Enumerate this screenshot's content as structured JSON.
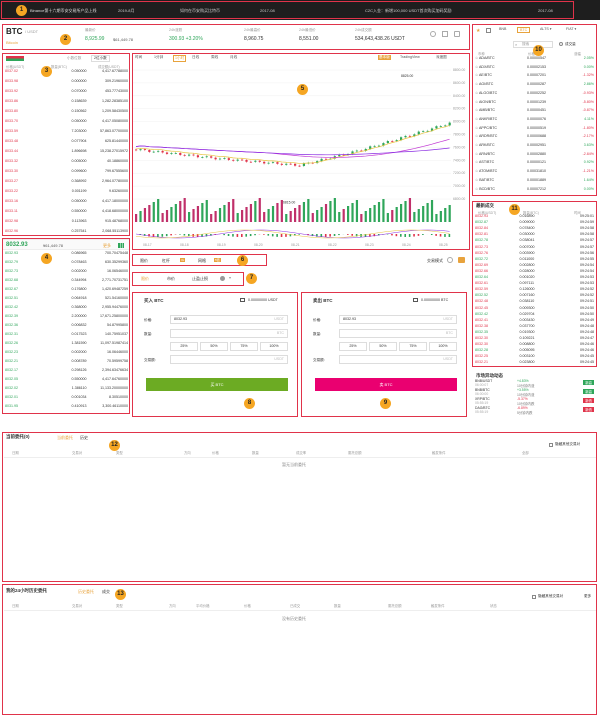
{
  "announce": {
    "text": "Binance第十六期币安交易所产品上线",
    "date1": "2019-8月",
    "text2": "如何在币安购买比特币",
    "date2": "2017-08",
    "text3": "C2C入金：新增100,000 USDT首次购买加码奖励",
    "date3": "2017-08"
  },
  "ticker": {
    "pair": "BTC",
    "quote": "/ USDT",
    "sub": "Bitcoin",
    "last_label": "最新价",
    "last_price": "8,925.99",
    "last_usd": "$61,449.78",
    "change_label": "24h涨跌",
    "change": "300.93 +3.20%",
    "high_label": "24h最高价",
    "high": "8,960.75",
    "low_label": "24h最低价",
    "low": "8,551.00",
    "vol_label": "24h成交额",
    "vol": "534,643,438.26 USDT"
  },
  "orderbook": {
    "title": "订单簿",
    "group": "小数位数",
    "group_val": "2位小数",
    "cols": [
      "价格(USDT)",
      "数量(BTC)",
      "成交额(USDT)"
    ],
    "asks": [
      [
        "8037.02",
        "0.050000",
        "4,417.67788000"
      ],
      [
        "8033.98",
        "0.000000",
        "309.21960000"
      ],
      [
        "8033.92",
        "0.070000",
        "453.77743000"
      ],
      [
        "8033.86",
        "0.158639",
        "1,282.28385100"
      ],
      [
        "8033.80",
        "0.150562",
        "1,209.58430500"
      ],
      [
        "8033.70",
        "0.050000",
        "4,417.05080000"
      ],
      [
        "8033.59",
        "7.203000",
        "57,863.07700000"
      ],
      [
        "8033.48",
        "0.077904",
        "625.81440000"
      ],
      [
        "8033.44",
        "1.896698",
        "15,238.27015972"
      ],
      [
        "8033.32",
        "0.005000",
        "40.18860000"
      ],
      [
        "8033.30",
        "0.099600",
        "799.67555600"
      ],
      [
        "8033.27",
        "0.368992",
        "2,964.07780000"
      ],
      [
        "8033.22",
        "0.001199",
        "9.63260000"
      ],
      [
        "8033.16",
        "0.050000",
        "4,417.18000000"
      ],
      [
        "8033.11",
        "0.550000",
        "4,418.68000000"
      ],
      [
        "8032.98",
        "0.113963",
        "915.48768000"
      ],
      [
        "8032.96",
        "0.257541",
        "2,068.55113900"
      ]
    ],
    "mid_price": "8032.93",
    "mid_usd": "¥61,449.78",
    "more": "更多",
    "bids": [
      [
        "8032.93",
        "0.086965",
        "700.70475448"
      ],
      [
        "8032.79",
        "0.078463",
        "630.35299360"
      ],
      [
        "8032.73",
        "0.002000",
        "16.06546000"
      ],
      [
        "8032.68",
        "0.344994",
        "2,771.70731751"
      ],
      [
        "8032.67",
        "0.176800",
        "1,420.69487259"
      ],
      [
        "8032.51",
        "0.064918",
        "521.54160000"
      ],
      [
        "8032.42",
        "0.368000",
        "2,955.94476000"
      ],
      [
        "8032.39",
        "2.200000",
        "17,671.25800000"
      ],
      [
        "8032.36",
        "0.006832",
        "54.87995800"
      ],
      [
        "8032.31",
        "0.017523",
        "140.75951037"
      ],
      [
        "8032.26",
        "1.381590",
        "11,097.51987414"
      ],
      [
        "8032.23",
        "0.002000",
        "16.06446000"
      ],
      [
        "8032.21",
        "0.008789",
        "70.59599758"
      ],
      [
        "8032.17",
        "0.298126",
        "2,394.63476634"
      ],
      [
        "8032.05",
        "0.550000",
        "4,417.64760000"
      ],
      [
        "8032.02",
        "1.386110",
        "11,133.20000000"
      ],
      [
        "8032.01",
        "0.001034",
        "8.30510000"
      ],
      [
        "8031.95",
        "0.410913",
        "3,300.46110000"
      ]
    ]
  },
  "chart": {
    "intervals": [
      "时间",
      "1分钟",
      "1小时",
      "日线",
      "周线",
      "月线"
    ],
    "interval_sel": "1小时",
    "views": [
      "基本版",
      "TradingView",
      "深度图"
    ],
    "view_sel": "基本版",
    "hi_label": "8825.00",
    "lo_label": "6815.00",
    "yticks": [
      "8800.00",
      "8600.00",
      "8400.00",
      "8200.00",
      "8000.00",
      "7800.00",
      "7600.00",
      "7400.00",
      "7200.00",
      "7000.00",
      "6800.00"
    ],
    "xticks": [
      "08-17",
      "08-18",
      "08-19",
      "08-20",
      "08-21",
      "08-22",
      "08-23",
      "08-24",
      "08-25"
    ]
  },
  "trade": {
    "tabs": [
      "限价",
      "杠杆",
      "网格"
    ],
    "tab_badges": [
      "",
      "3x",
      "5倍"
    ],
    "order_types": [
      "限价",
      "市价",
      "止盈止损"
    ],
    "order_sel": "限价",
    "buy": {
      "title": "买入 BTC",
      "balance": "0.00000000 USDT",
      "price_label": "价格:",
      "price": "8032.93",
      "price_unit": "USDT",
      "amount_label": "数量:",
      "amount_unit": "BTC",
      "total_label": "交易额:",
      "total_unit": "USDT",
      "btn": "买 BTC"
    },
    "sell": {
      "title": "卖出 BTC",
      "balance": "0.00000000 BTC",
      "price_label": "价格:",
      "price": "8032.93",
      "price_unit": "USDT",
      "amount_label": "数量:",
      "amount_unit": "BTC",
      "total_label": "交易额:",
      "total_unit": "USDT",
      "btn": "卖 BTC"
    },
    "pcts": [
      "25%",
      "50%",
      "75%",
      "100%"
    ],
    "switch_label": "交易模式"
  },
  "markets": {
    "tabs": [
      "BNB",
      "BTC",
      "ALTS",
      "FIAT"
    ],
    "tab_sel": "BTC",
    "search": "搜索",
    "filter": "成交量",
    "cols": [
      "币种",
      "价格",
      "涨幅"
    ],
    "rows": [
      [
        "ADA/BTC",
        "0.00000547",
        "2.05%"
      ],
      [
        "ADX/BTC",
        "0.00002153",
        "0.00%"
      ],
      [
        "AE/BTC",
        "0.00007201",
        "-1.32%"
      ],
      [
        "AGI/BTC",
        "0.00000287",
        "2.86%"
      ],
      [
        "ALGO/BTC",
        "0.00002252",
        "-0.93%"
      ],
      [
        "AION/BTC",
        "0.00001239",
        "-5.80%"
      ],
      [
        "AMB/BTC",
        "0.00000451",
        "-0.87%"
      ],
      [
        "ANKR/BTC",
        "0.00000076",
        "4.11%"
      ],
      [
        "APPC/BTC",
        "0.00000519",
        "-1.80%"
      ],
      [
        "ARDR/BTC",
        "0.00000688",
        "-2.17%"
      ],
      [
        "ARK/BTC",
        "0.00002951",
        "3.63%"
      ],
      [
        "ARN/BTC",
        "0.00002880",
        "-2.84%"
      ],
      [
        "AST/BTC",
        "0.00000121",
        "0.92%"
      ],
      [
        "ATOM/BTC",
        "0.00031810",
        "-1.21%"
      ],
      [
        "BAT/BTC",
        "0.00001889",
        "1.64%"
      ],
      [
        "BCD/BTC",
        "0.00007212",
        "0.00%"
      ]
    ]
  },
  "trades": {
    "title": "最新成交",
    "cols": [
      "价格(USDT)",
      "数量(BTC)",
      "时间"
    ],
    "rows": [
      [
        "8032.93",
        "0.016890",
        "09:25:01"
      ],
      [
        "8032.87",
        "0.009000",
        "09:24:59"
      ],
      [
        "8032.84",
        "0.078400",
        "09:24:58"
      ],
      [
        "8032.81",
        "0.030000",
        "09:24:58"
      ],
      [
        "8032.78",
        "0.038041",
        "09:24:57"
      ],
      [
        "8032.73",
        "0.007000",
        "09:24:57"
      ],
      [
        "8032.76",
        "0.003900",
        "09:24:56"
      ],
      [
        "8032.72",
        "0.011000",
        "09:24:55"
      ],
      [
        "8032.69",
        "0.002800",
        "09:24:54"
      ],
      [
        "8032.66",
        "0.028000",
        "09:24:54"
      ],
      [
        "8032.64",
        "0.001020",
        "09:24:53"
      ],
      [
        "8032.61",
        "0.097111",
        "09:24:53"
      ],
      [
        "8032.59",
        "0.126000",
        "09:24:52"
      ],
      [
        "8032.52",
        "0.007160",
        "09:24:52"
      ],
      [
        "8032.48",
        "0.038110",
        "09:24:51"
      ],
      [
        "8032.45",
        "0.009300",
        "09:24:50"
      ],
      [
        "8032.42",
        "0.029704",
        "09:24:50"
      ],
      [
        "8032.41",
        "0.003430",
        "09:24:49"
      ],
      [
        "8032.38",
        "0.037700",
        "09:24:48"
      ],
      [
        "8032.35",
        "0.019300",
        "09:24:48"
      ],
      [
        "8032.30",
        "0.109221",
        "09:24:47"
      ],
      [
        "8032.30",
        "0.008800",
        "09:24:46"
      ],
      [
        "8032.28",
        "0.005095",
        "09:24:46"
      ],
      [
        "8032.25",
        "0.003100",
        "09:24:45"
      ],
      [
        "8032.21",
        "0.023800",
        "09:24:45"
      ]
    ]
  },
  "movers": {
    "title": "市场异动动态",
    "rows": [
      [
        "BNB/USDT",
        "+4.83%",
        "10分钟内涨",
        "06:00:07",
        "新高"
      ],
      [
        "BNB/BTC",
        "+3.55%",
        "10分钟内涨",
        "06:00:00",
        "新高"
      ],
      [
        "XRP/BTC",
        "-5.37%",
        "10分钟内跌",
        "05:55:19",
        "新低"
      ],
      [
        "DAG/BTC",
        "-6.89%",
        "5分钟内跌",
        "05:55:19",
        "新低"
      ]
    ]
  },
  "open_orders": {
    "title": "当前委托(0)",
    "tabs": [
      "当前委托",
      "历史"
    ],
    "hide": "隐藏其他交易对",
    "cols": [
      "日期",
      "交易对",
      "类型",
      "方向",
      "价格",
      "数量",
      "成交率",
      "委托总额",
      "触发条件",
      "全部"
    ],
    "empty": "暂无当前委托"
  },
  "history": {
    "title": "我的24小时历史委托",
    "tabs": [
      "历史委托",
      "成交"
    ],
    "hide": "隐藏其他交易对",
    "more": "更多",
    "cols": [
      "日期",
      "交易对",
      "类型",
      "方向",
      "平均价格",
      "价格",
      "已成交",
      "数量",
      "委托总额",
      "触发条件",
      "状态"
    ],
    "empty": "没有历史委托"
  },
  "marks": [
    "1",
    "2",
    "3",
    "4",
    "5",
    "6",
    "7",
    "8",
    "9",
    "10",
    "11",
    "12",
    "13"
  ]
}
